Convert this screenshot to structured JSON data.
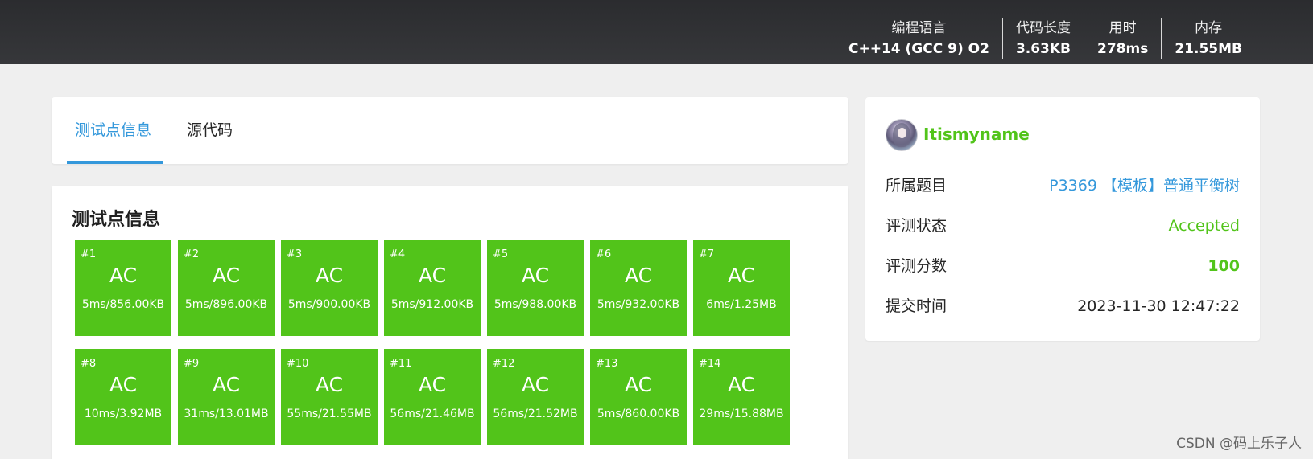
{
  "header": {
    "stats": [
      {
        "label": "编程语言",
        "value": "C++14 (GCC 9) O2"
      },
      {
        "label": "代码长度",
        "value": "3.63KB"
      },
      {
        "label": "用时",
        "value": "278ms"
      },
      {
        "label": "内存",
        "value": "21.55MB"
      }
    ]
  },
  "tabs": [
    {
      "label": "测试点信息",
      "active": true
    },
    {
      "label": "源代码",
      "active": false
    }
  ],
  "tests": {
    "title": "测试点信息",
    "cases": [
      {
        "id": "#1",
        "status": "AC",
        "detail": "5ms/856.00KB"
      },
      {
        "id": "#2",
        "status": "AC",
        "detail": "5ms/896.00KB"
      },
      {
        "id": "#3",
        "status": "AC",
        "detail": "5ms/900.00KB"
      },
      {
        "id": "#4",
        "status": "AC",
        "detail": "5ms/912.00KB"
      },
      {
        "id": "#5",
        "status": "AC",
        "detail": "5ms/988.00KB"
      },
      {
        "id": "#6",
        "status": "AC",
        "detail": "5ms/932.00KB"
      },
      {
        "id": "#7",
        "status": "AC",
        "detail": "6ms/1.25MB"
      },
      {
        "id": "#8",
        "status": "AC",
        "detail": "10ms/3.92MB"
      },
      {
        "id": "#9",
        "status": "AC",
        "detail": "31ms/13.01MB"
      },
      {
        "id": "#10",
        "status": "AC",
        "detail": "55ms/21.55MB"
      },
      {
        "id": "#11",
        "status": "AC",
        "detail": "56ms/21.46MB"
      },
      {
        "id": "#12",
        "status": "AC",
        "detail": "56ms/21.52MB"
      },
      {
        "id": "#13",
        "status": "AC",
        "detail": "5ms/860.00KB"
      },
      {
        "id": "#14",
        "status": "AC",
        "detail": "29ms/15.88MB"
      }
    ]
  },
  "info": {
    "username": "Itismyname",
    "problem_label": "所属题目",
    "problem_value": "P3369 【模板】普通平衡树",
    "status_label": "评测状态",
    "status_value": "Accepted",
    "score_label": "评测分数",
    "score_value": "100",
    "time_label": "提交时间",
    "time_value": "2023-11-30 12:47:22"
  },
  "colors": {
    "accent": "#3498db",
    "success": "#52c41a",
    "topbar": "#2f3033"
  },
  "watermark": "CSDN @码上乐子人"
}
